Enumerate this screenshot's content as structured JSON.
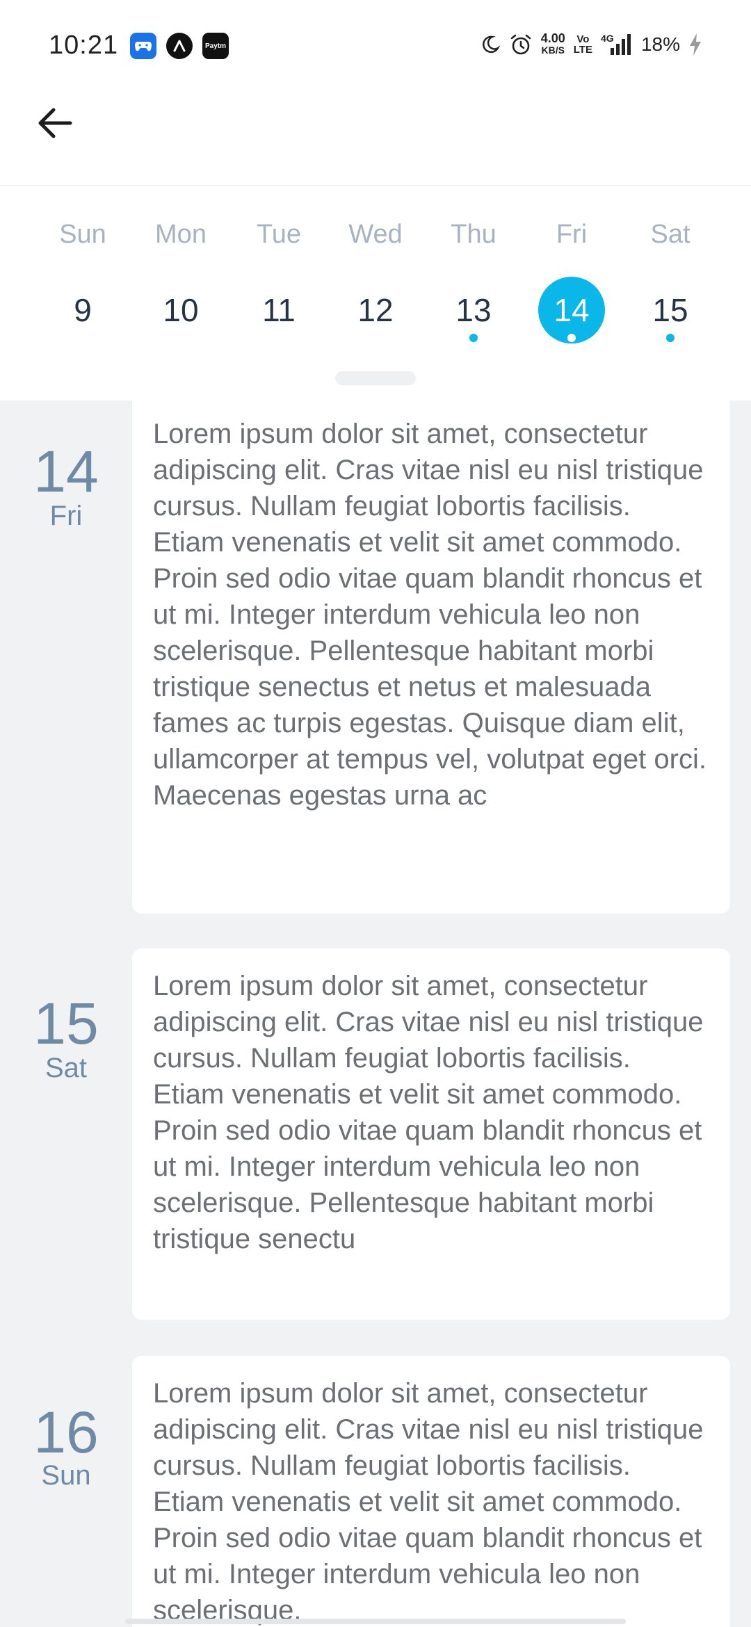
{
  "status_bar": {
    "time": "10:21",
    "network_speed_value": "4.00",
    "network_speed_unit": "KB/S",
    "volte_top": "Vo",
    "volte_bottom": "LTE",
    "network_type": "4G",
    "battery": "18%"
  },
  "notif_icons": [
    "game-controller-icon",
    "arc-logo-icon",
    "paytm-icon"
  ],
  "notif_paytm_label": "Paytm",
  "status_icons": [
    "moon-icon",
    "alarm-icon",
    "signal-icon",
    "charging-icon"
  ],
  "header": {
    "back_icon": "arrow-left-icon"
  },
  "week": {
    "days": [
      {
        "name": "Sun",
        "number": "9",
        "has_event": false,
        "selected": false
      },
      {
        "name": "Mon",
        "number": "10",
        "has_event": false,
        "selected": false
      },
      {
        "name": "Tue",
        "number": "11",
        "has_event": false,
        "selected": false
      },
      {
        "name": "Wed",
        "number": "12",
        "has_event": false,
        "selected": false
      },
      {
        "name": "Thu",
        "number": "13",
        "has_event": true,
        "selected": false
      },
      {
        "name": "Fri",
        "number": "14",
        "has_event": true,
        "selected": true
      },
      {
        "name": "Sat",
        "number": "15",
        "has_event": true,
        "selected": false
      }
    ],
    "accent_color": "#0ab7e8"
  },
  "agenda": [
    {
      "date_number": "14",
      "day_name": "Fri",
      "text": "Lorem ipsum dolor sit amet, consectetur adipiscing elit. Cras vitae nisl eu nisl tristique cursus. Nullam feugiat lobortis facilisis. Etiam venenatis et velit sit amet commodo. Proin sed odio vitae quam blandit rhoncus et ut mi. Integer interdum vehicula leo non scelerisque. Pellentesque habitant morbi tristique senectus et netus et malesuada fames ac turpis egestas. Quisque diam elit, ullamcorper at tempus vel, volutpat eget orci. Maecenas egestas urna ac"
    },
    {
      "date_number": "15",
      "day_name": "Sat",
      "text": "Lorem ipsum dolor sit amet, consectetur adipiscing elit. Cras vitae nisl eu nisl tristique cursus. Nullam feugiat lobortis facilisis. Etiam venenatis et velit sit amet commodo. Proin sed odio vitae quam blandit rhoncus et ut mi. Integer interdum vehicula leo non scelerisque. Pellentesque habitant morbi tristique senectu"
    },
    {
      "date_number": "16",
      "day_name": "Sun",
      "text": "Lorem ipsum dolor sit amet, consectetur adipiscing elit. Cras vitae nisl eu nisl tristique cursus. Nullam feugiat lobortis facilisis. Etiam venenatis et velit sit amet commodo. Proin sed odio vitae quam blandit rhoncus et ut mi. Integer interdum vehicula leo non scelerisque."
    }
  ]
}
